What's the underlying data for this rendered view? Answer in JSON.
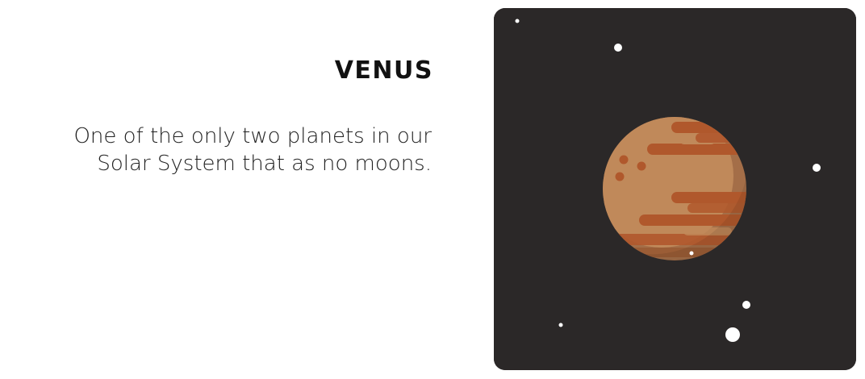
{
  "planet": {
    "title": "VENUS",
    "description_lines": [
      "One of the only two planets in our",
      "Solar System that as no moons."
    ]
  },
  "illustration": {
    "icon": "venus-planet-illustration",
    "colors": {
      "background": "#2b2828",
      "planet_base": "#c0895a",
      "planet_shadow": "#a46e48",
      "bands": "#b0582c",
      "stars": "#ffffff"
    }
  }
}
